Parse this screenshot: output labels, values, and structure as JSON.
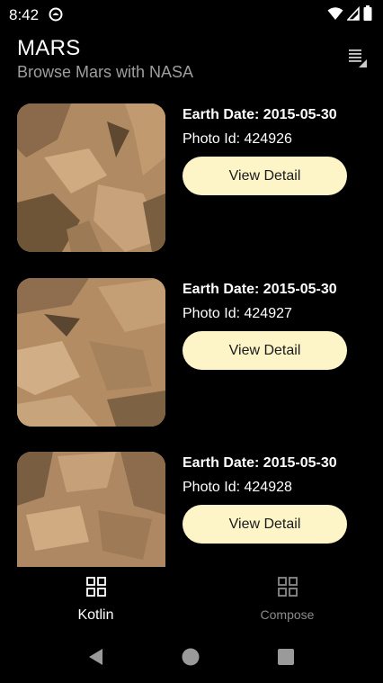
{
  "status_bar": {
    "time": "8:42",
    "icons": [
      "app-notification-icon",
      "wifi-icon",
      "signal-icon",
      "battery-icon"
    ]
  },
  "header": {
    "title": "MARS",
    "subtitle": "Browse Mars with NASA",
    "menu_icon": "view-list-icon"
  },
  "photos": [
    {
      "earth_date": "Earth Date: 2015-05-30",
      "photo_id": "Photo Id: 424926",
      "button_label": "View Detail"
    },
    {
      "earth_date": "Earth Date: 2015-05-30",
      "photo_id": "Photo Id: 424927",
      "button_label": "View Detail"
    },
    {
      "earth_date": "Earth Date: 2015-05-30",
      "photo_id": "Photo Id: 424928",
      "button_label": "View Detail"
    }
  ],
  "bottom_nav": {
    "items": [
      {
        "label": "Kotlin",
        "icon": "grid-icon",
        "selected": true
      },
      {
        "label": "Compose",
        "icon": "grid-icon",
        "selected": false
      }
    ]
  },
  "system_nav": {
    "buttons": [
      "back-icon",
      "home-icon",
      "recents-icon"
    ]
  },
  "colors": {
    "background": "#000000",
    "button": "#fdf5c8",
    "subtitle": "#9e9e9e",
    "inactive_nav": "#8a8a8a"
  }
}
